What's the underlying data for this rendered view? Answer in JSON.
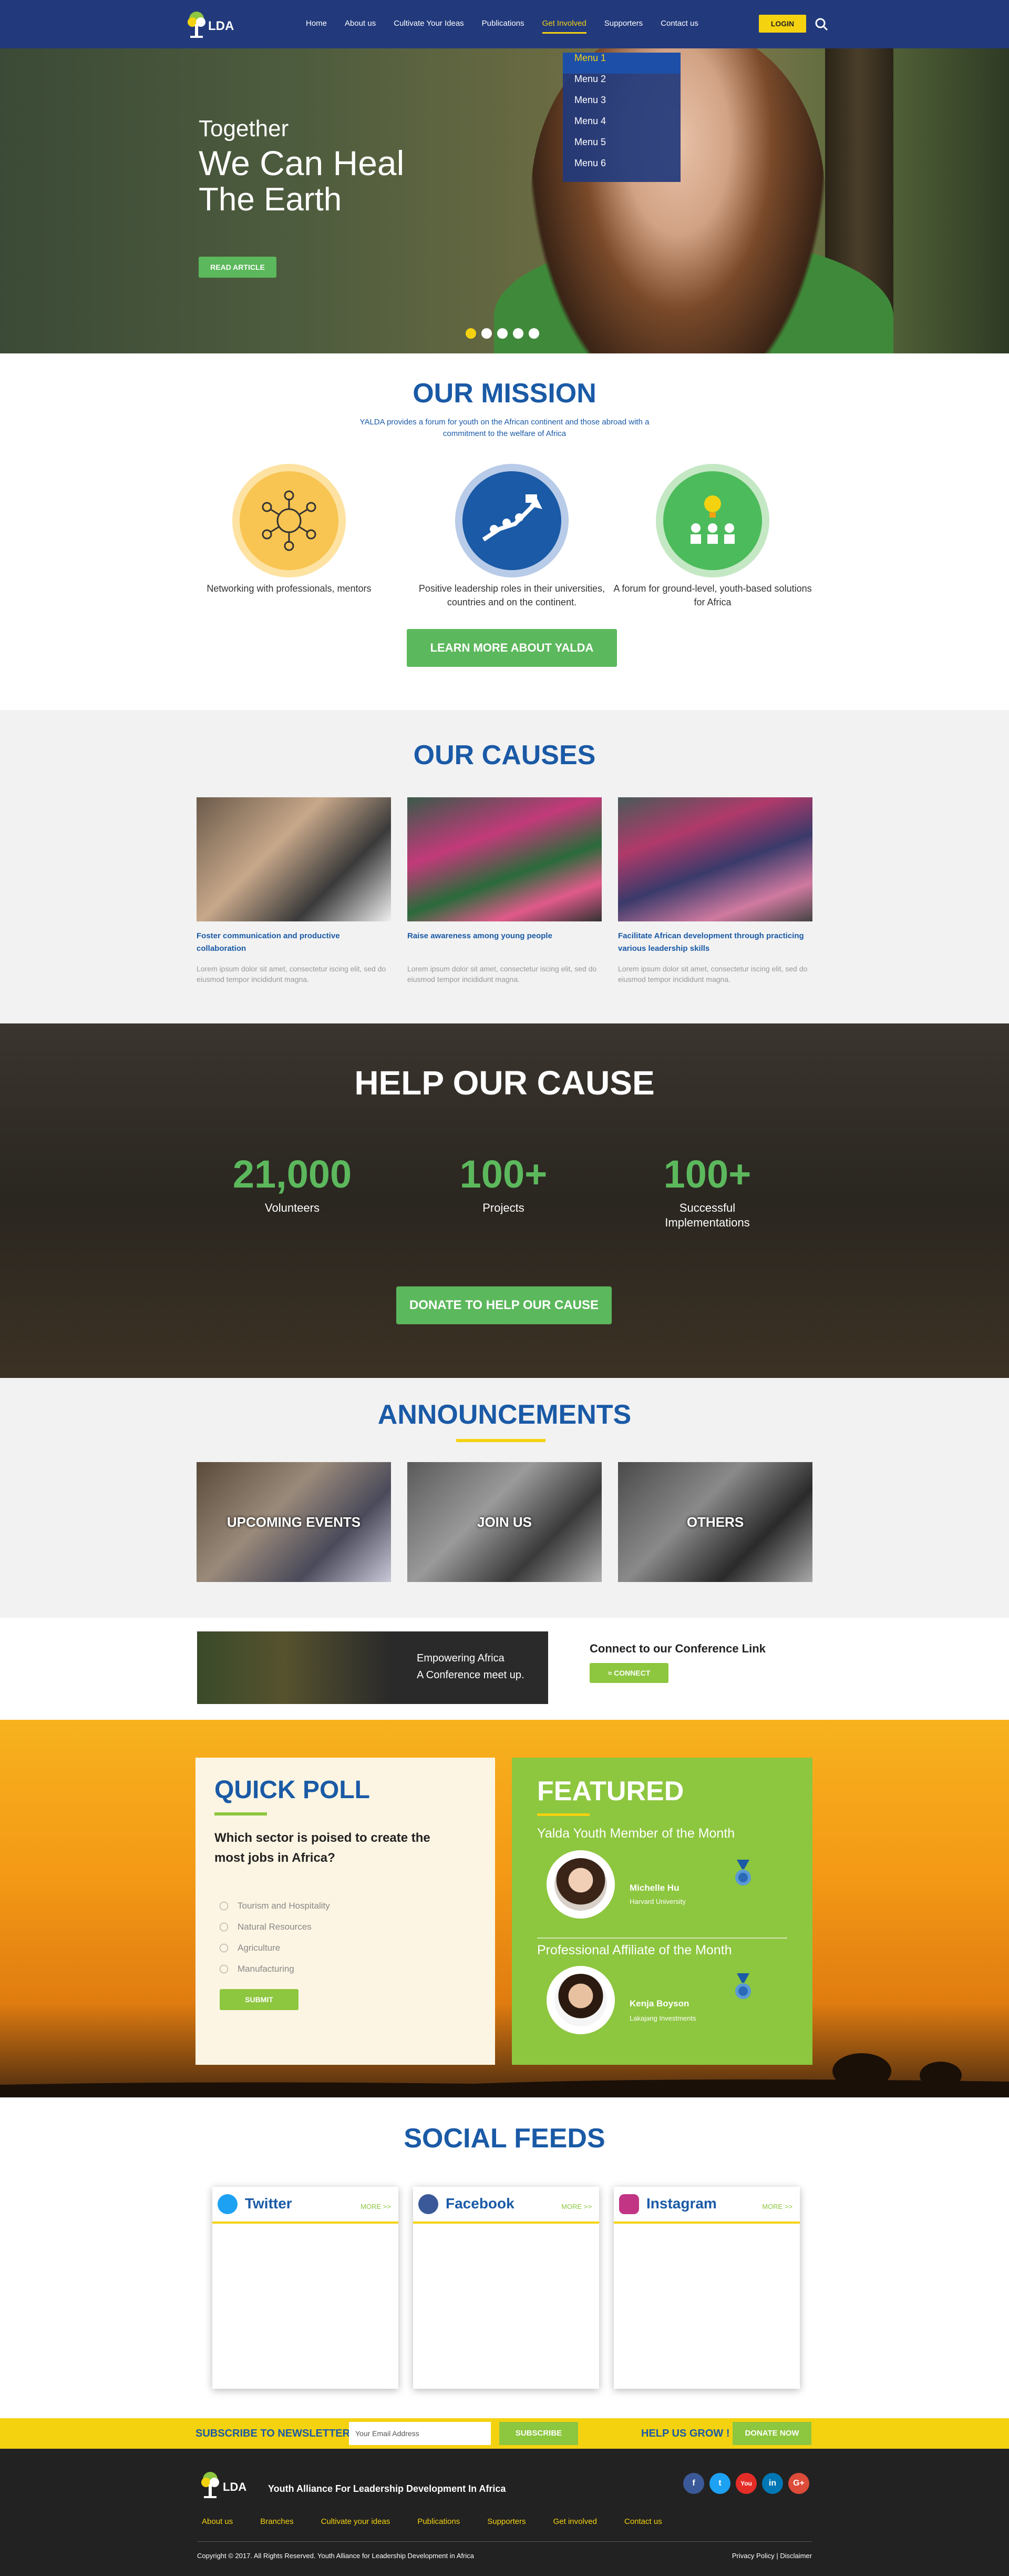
{
  "header": {
    "logo_text": "LDA",
    "nav": [
      "Home",
      "About us",
      "Cultivate Your Ideas",
      "Publications",
      "Get Involved",
      "Supporters",
      "Contact us"
    ],
    "active_nav": "Get Involved",
    "login": "LOGIN",
    "dropdown": [
      "Menu 1",
      "Menu 2",
      "Menu 3",
      "Menu 4",
      "Menu 5",
      "Menu 6"
    ]
  },
  "hero": {
    "line1": "Together",
    "line2": "We Can Heal",
    "line3": "The Earth",
    "button": "READ ARTICLE",
    "slides": 5,
    "active_slide": 1
  },
  "mission": {
    "title": "OUR MISSION",
    "desc": "YALDA provides a forum for youth on the African continent and those abroad with a commitment to the welfare of Africa",
    "items": [
      "Networking with professionals, mentors",
      "Positive leadership roles in their universities, countries and on the continent.",
      "A forum for ground-level, youth-based solutions for Africa"
    ],
    "button": "LEARN MORE ABOUT YALDA"
  },
  "causes": {
    "title": "OUR CAUSES",
    "items": [
      {
        "title": "Foster communication and productive collaboration",
        "desc": "Lorem ipsum dolor sit amet, consectetur iscing elit, sed do eiusmod tempor incididunt magna."
      },
      {
        "title": "Raise awareness among young people",
        "desc": "Lorem ipsum dolor sit amet, consectetur iscing elit, sed do eiusmod tempor incididunt magna."
      },
      {
        "title": "Facilitate African development through practicing various leadership skills",
        "desc": "Lorem ipsum dolor sit amet, consectetur iscing elit, sed do eiusmod tempor incididunt magna."
      }
    ]
  },
  "help": {
    "title": "HELP OUR CAUSE",
    "stats": [
      {
        "value": "21,000",
        "label": "Volunteers"
      },
      {
        "value": "100+",
        "label": "Projects"
      },
      {
        "value": "100+",
        "label": "Successful Implementations"
      }
    ],
    "button": "DONATE TO HELP OUR CAUSE"
  },
  "announcements": {
    "title": "ANNOUNCEMENTS",
    "tiles": [
      "UPCOMING EVENTS",
      "JOIN US",
      "OTHERS"
    ]
  },
  "conference": {
    "line1": "Empowering Africa",
    "line2": "A Conference meet up.",
    "link_title": "Connect to our Conference Link",
    "button": "CONNECT"
  },
  "poll": {
    "title": "QUICK POLL",
    "question": "Which sector is poised to create the most jobs in Africa?",
    "options": [
      "Tourism and Hospitality",
      "Natural Resources",
      "Agriculture",
      "Manufacturing"
    ],
    "button": "SUBMIT"
  },
  "featured": {
    "title": "FEATURED",
    "people": [
      {
        "section": "Yalda Youth Member of the Month",
        "name": "Michelle Hu",
        "org": "Harvard University"
      },
      {
        "section": "Professional Affiliate of the Month",
        "name": "Kenja Boyson",
        "org": "Lakajang Investments"
      }
    ]
  },
  "social": {
    "title": "SOCIAL FEEDS",
    "cards": [
      {
        "name": "Twitter",
        "more": "MORE >>",
        "color": "#1da1f2"
      },
      {
        "name": "Facebook",
        "more": "MORE >>",
        "color": "#3b5998"
      },
      {
        "name": "Instagram",
        "more": "MORE >>",
        "color": "#c13584"
      }
    ]
  },
  "newsletter": {
    "label": "SUBSCRIBE TO NEWSLETTER",
    "placeholder": "Your Email Address",
    "button": "SUBSCRIBE",
    "help": "HELP US GROW !",
    "donate": "DONATE NOW"
  },
  "footer": {
    "logo_text": "LDA",
    "org_name": "Youth Alliance For Leadership Development In Africa",
    "social": [
      "f",
      "t",
      "You",
      "in",
      "G+"
    ],
    "links": [
      "About us",
      "Branches",
      "Cultivate your ideas",
      "Publications",
      "Supporters",
      "Get involved",
      "Contact us"
    ],
    "copyright": "Copyright © 2017. All Rights Reserved. Youth Alliance for Leadership Development in Africa",
    "policy": "Privacy Policy | Disclaimer"
  },
  "colors": {
    "nav_bg": "#223a7c",
    "accent_yellow": "#f4d210",
    "green": "#5cb85c",
    "blue": "#1a5aa6",
    "lime": "#8dc63f"
  }
}
